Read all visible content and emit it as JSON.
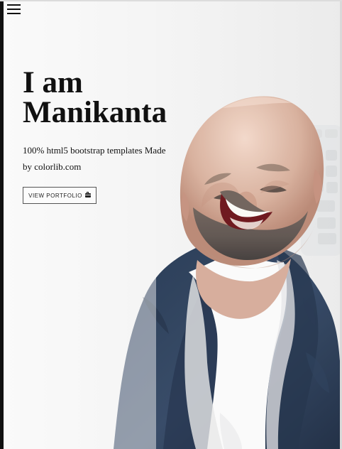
{
  "nav": {
    "menu_icon": "hamburger-menu-icon"
  },
  "hero": {
    "title": "I am Manikanta",
    "description": "100% html5 bootstrap templates Made by colorlib.com",
    "button_label": "VIEW PORTFOLIO",
    "button_icon": "briefcase-icon"
  },
  "colors": {
    "background": "#f4f4f4",
    "text": "#111111",
    "suit": "#263b57",
    "shirt": "#f7f7f7",
    "skin": "#d8b5a1"
  }
}
